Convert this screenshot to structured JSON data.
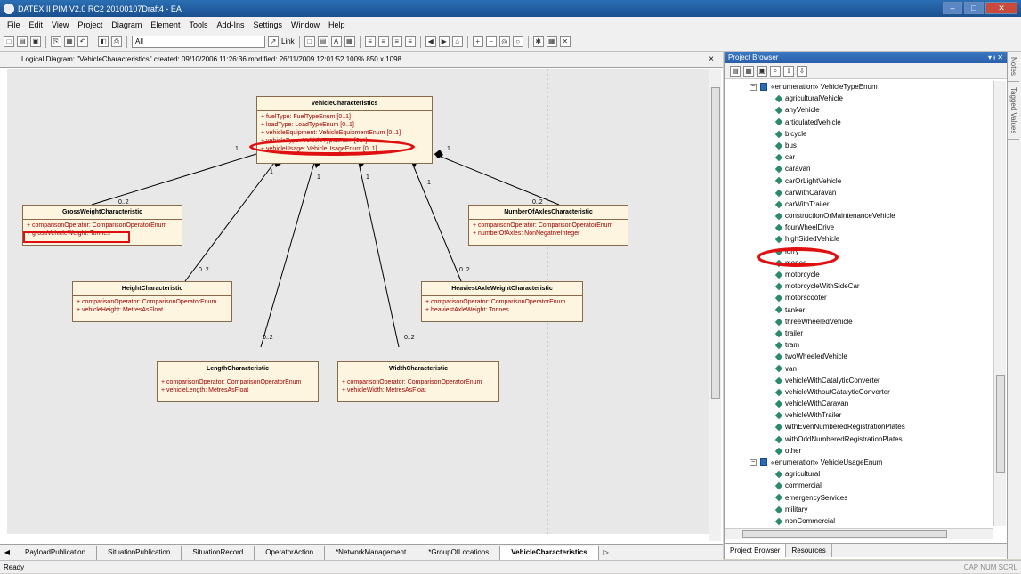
{
  "window": {
    "title": "DATEX II PIM V2.0 RC2 20100107Draft4 - EA"
  },
  "menu": [
    "File",
    "Edit",
    "View",
    "Project",
    "Diagram",
    "Element",
    "Tools",
    "Add-Ins",
    "Settings",
    "Window",
    "Help"
  ],
  "toolbar": {
    "filter_value": "All",
    "link_label": "Link"
  },
  "diagram": {
    "header": "Logical Diagram: \"VehicleCharacteristics\"  created: 09/10/2006 11:26:36  modified: 26/11/2009 12:01:52  100%  850 x 1098",
    "classes": [
      {
        "id": "vc",
        "name": "VehicleCharacteristics",
        "attrs": [
          "+ fuelType:  FuelTypeEnum [0..1]",
          "+ loadType:  LoadTypeEnum [0..1]",
          "+ vehicleEquipment:  VehicleEquipmentEnum [0..1]",
          "+ vehicleType:  VehicleTypeEnum [0..*]",
          "+ vehicleUsage:  VehicleUsageEnum [0..1]"
        ]
      },
      {
        "id": "gw",
        "name": "GrossWeightCharacteristic",
        "attrs": [
          "+ comparisonOperator:  ComparisonOperatorEnum",
          "+ grossVehicleWeight:  Tonnes"
        ]
      },
      {
        "id": "na",
        "name": "NumberOfAxlesCharacteristic",
        "attrs": [
          "+ comparisonOperator:  ComparisonOperatorEnum",
          "+ numberOfAxles:  NonNegativeInteger"
        ]
      },
      {
        "id": "hc",
        "name": "HeightCharacteristic",
        "attrs": [
          "+ comparisonOperator:  ComparisonOperatorEnum",
          "+ vehicleHeight:  MetresAsFloat"
        ]
      },
      {
        "id": "ha",
        "name": "HeaviestAxleWeightCharacteristic",
        "attrs": [
          "+ comparisonOperator:  ComparisonOperatorEnum",
          "+ heaviestAxleWeight:  Tonnes"
        ]
      },
      {
        "id": "lc",
        "name": "LengthCharacteristic",
        "attrs": [
          "+ comparisonOperator:  ComparisonOperatorEnum",
          "+ vehicleLength:  MetresAsFloat"
        ]
      },
      {
        "id": "wc",
        "name": "WidthCharacteristic",
        "attrs": [
          "+ comparisonOperator:  ComparisonOperatorEnum",
          "+ vehicleWidth:  MetresAsFloat"
        ]
      }
    ],
    "mult_one": "1",
    "mult_many": "0..2"
  },
  "tabs": [
    "PayloadPublication",
    "SituationPublication",
    "SituationRecord",
    "OperatorAction",
    "*NetworkManagement",
    "*GroupOfLocations",
    "VehicleCharacteristics"
  ],
  "project_browser": {
    "title": "Project Browser",
    "enum1": "«enumeration» VehicleTypeEnum",
    "items": [
      "agriculturalVehicle",
      "anyVehicle",
      "articulatedVehicle",
      "bicycle",
      "bus",
      "car",
      "caravan",
      "carOrLightVehicle",
      "carWithCaravan",
      "carWithTrailer",
      "constructionOrMaintenanceVehicle",
      "fourWheelDrive",
      "highSidedVehicle",
      "lorry",
      "moped",
      "motorcycle",
      "motorcycleWithSideCar",
      "motorscooter",
      "tanker",
      "threeWheeledVehicle",
      "trailer",
      "tram",
      "twoWheeledVehicle",
      "van",
      "vehicleWithCatalyticConverter",
      "vehicleWithoutCatalyticConverter",
      "vehicleWithCaravan",
      "vehicleWithTrailer",
      "withEvenNumberedRegistrationPlates",
      "withOddNumberedRegistrationPlates",
      "other"
    ],
    "enum2": "«enumeration» VehicleUsageEnum",
    "items2": [
      "agricultural",
      "commercial",
      "emergencyServices",
      "military",
      "nonCommercial"
    ],
    "tab_browser": "Project Browser",
    "tab_resources": "Resources"
  },
  "side_tabs": [
    "Notes",
    "Tagged Values"
  ],
  "status": {
    "left": "Ready",
    "right": "CAP  NUM  SCRL"
  }
}
